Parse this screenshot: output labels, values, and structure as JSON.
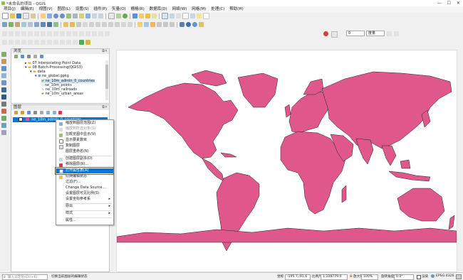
{
  "window": {
    "title": "*未命名的项目 - QGIS",
    "controls": [
      "—",
      "☐",
      "✕"
    ]
  },
  "menubar": [
    "项目(J)",
    "编辑(E)",
    "视图(V)",
    "图层(L)",
    "设置(S)",
    "插件(P)",
    "矢量(O)",
    "栅格(R)",
    "数据库(D)",
    "网络(W)",
    "网格(M)",
    "处理(C)",
    "帮助(H)"
  ],
  "toolbar": {
    "scale_value": "0",
    "crs_dropdown": "度量"
  },
  "browser_panel": {
    "title": "浏览",
    "tree": [
      {
        "label": "07 Interpolating Point Data"
      },
      {
        "label": "08 Batch-Processing(QGIS3)"
      },
      {
        "label": "data"
      },
      {
        "label": "ne_global.gpkg"
      },
      {
        "label": "ne_10m_admin_0_countries"
      },
      {
        "label": "ne_10m_points"
      },
      {
        "label": "ne_10m_railroads"
      },
      {
        "label": "ne_10m_urban_areas"
      }
    ]
  },
  "layers_panel": {
    "title": "图层",
    "layer_name": "ne_10m_admin_0_countries"
  },
  "context_menu": {
    "items": [
      {
        "label": "缩放到图层范围(Z)",
        "disabled": false,
        "submenu": false
      },
      {
        "label": "缩放到所选对象(S)",
        "disabled": true,
        "submenu": false
      },
      {
        "label": "在概览图中显示(V)",
        "disabled": false,
        "submenu": false
      },
      {
        "label": "显示要素数目",
        "disabled": false,
        "submenu": false
      },
      {
        "label": "复制图层",
        "disabled": false,
        "submenu": false
      },
      {
        "label": "图层重命名(N)",
        "disabled": false,
        "submenu": false
      },
      {
        "label": "创建图层副本(D)",
        "disabled": false,
        "submenu": false
      },
      {
        "label": "移除图层(R)...",
        "disabled": false,
        "submenu": false
      },
      {
        "label": "打开属性表(A)",
        "disabled": false,
        "submenu": false,
        "highlighted": true
      },
      {
        "label": "切换编辑状态",
        "disabled": false,
        "submenu": false
      },
      {
        "label": "过滤(F)...",
        "disabled": false,
        "submenu": false
      },
      {
        "label": "Change Data Source...",
        "disabled": false,
        "submenu": false
      },
      {
        "label": "设置图层可见比例(S)",
        "disabled": false,
        "submenu": false
      },
      {
        "label": "设置坐标参考系",
        "disabled": false,
        "submenu": true
      },
      {
        "label": "导出",
        "disabled": false,
        "submenu": true
      },
      {
        "label": "样式",
        "disabled": false,
        "submenu": true
      },
      {
        "label": "属性...",
        "disabled": false,
        "submenu": false
      }
    ]
  },
  "map": {
    "land_color": "#e0578b",
    "border_color": "#222222",
    "background": "#ffffff"
  },
  "statusbar": {
    "locator_placeholder": "输入以定位(Ctrl+K)",
    "message": "切换当前图层的编辑状态",
    "coord_label": "坐标",
    "coord_value": "-195.7,-91.6",
    "scale_label": "比例尺",
    "scale_value": "1:108779.0",
    "magnifier_label": "放大镜",
    "magnifier_value": "100%",
    "rotation_label": "旋转角度",
    "rotation_value": "0.0°",
    "render_label": "渲染",
    "crs": "EPSG:4326"
  }
}
